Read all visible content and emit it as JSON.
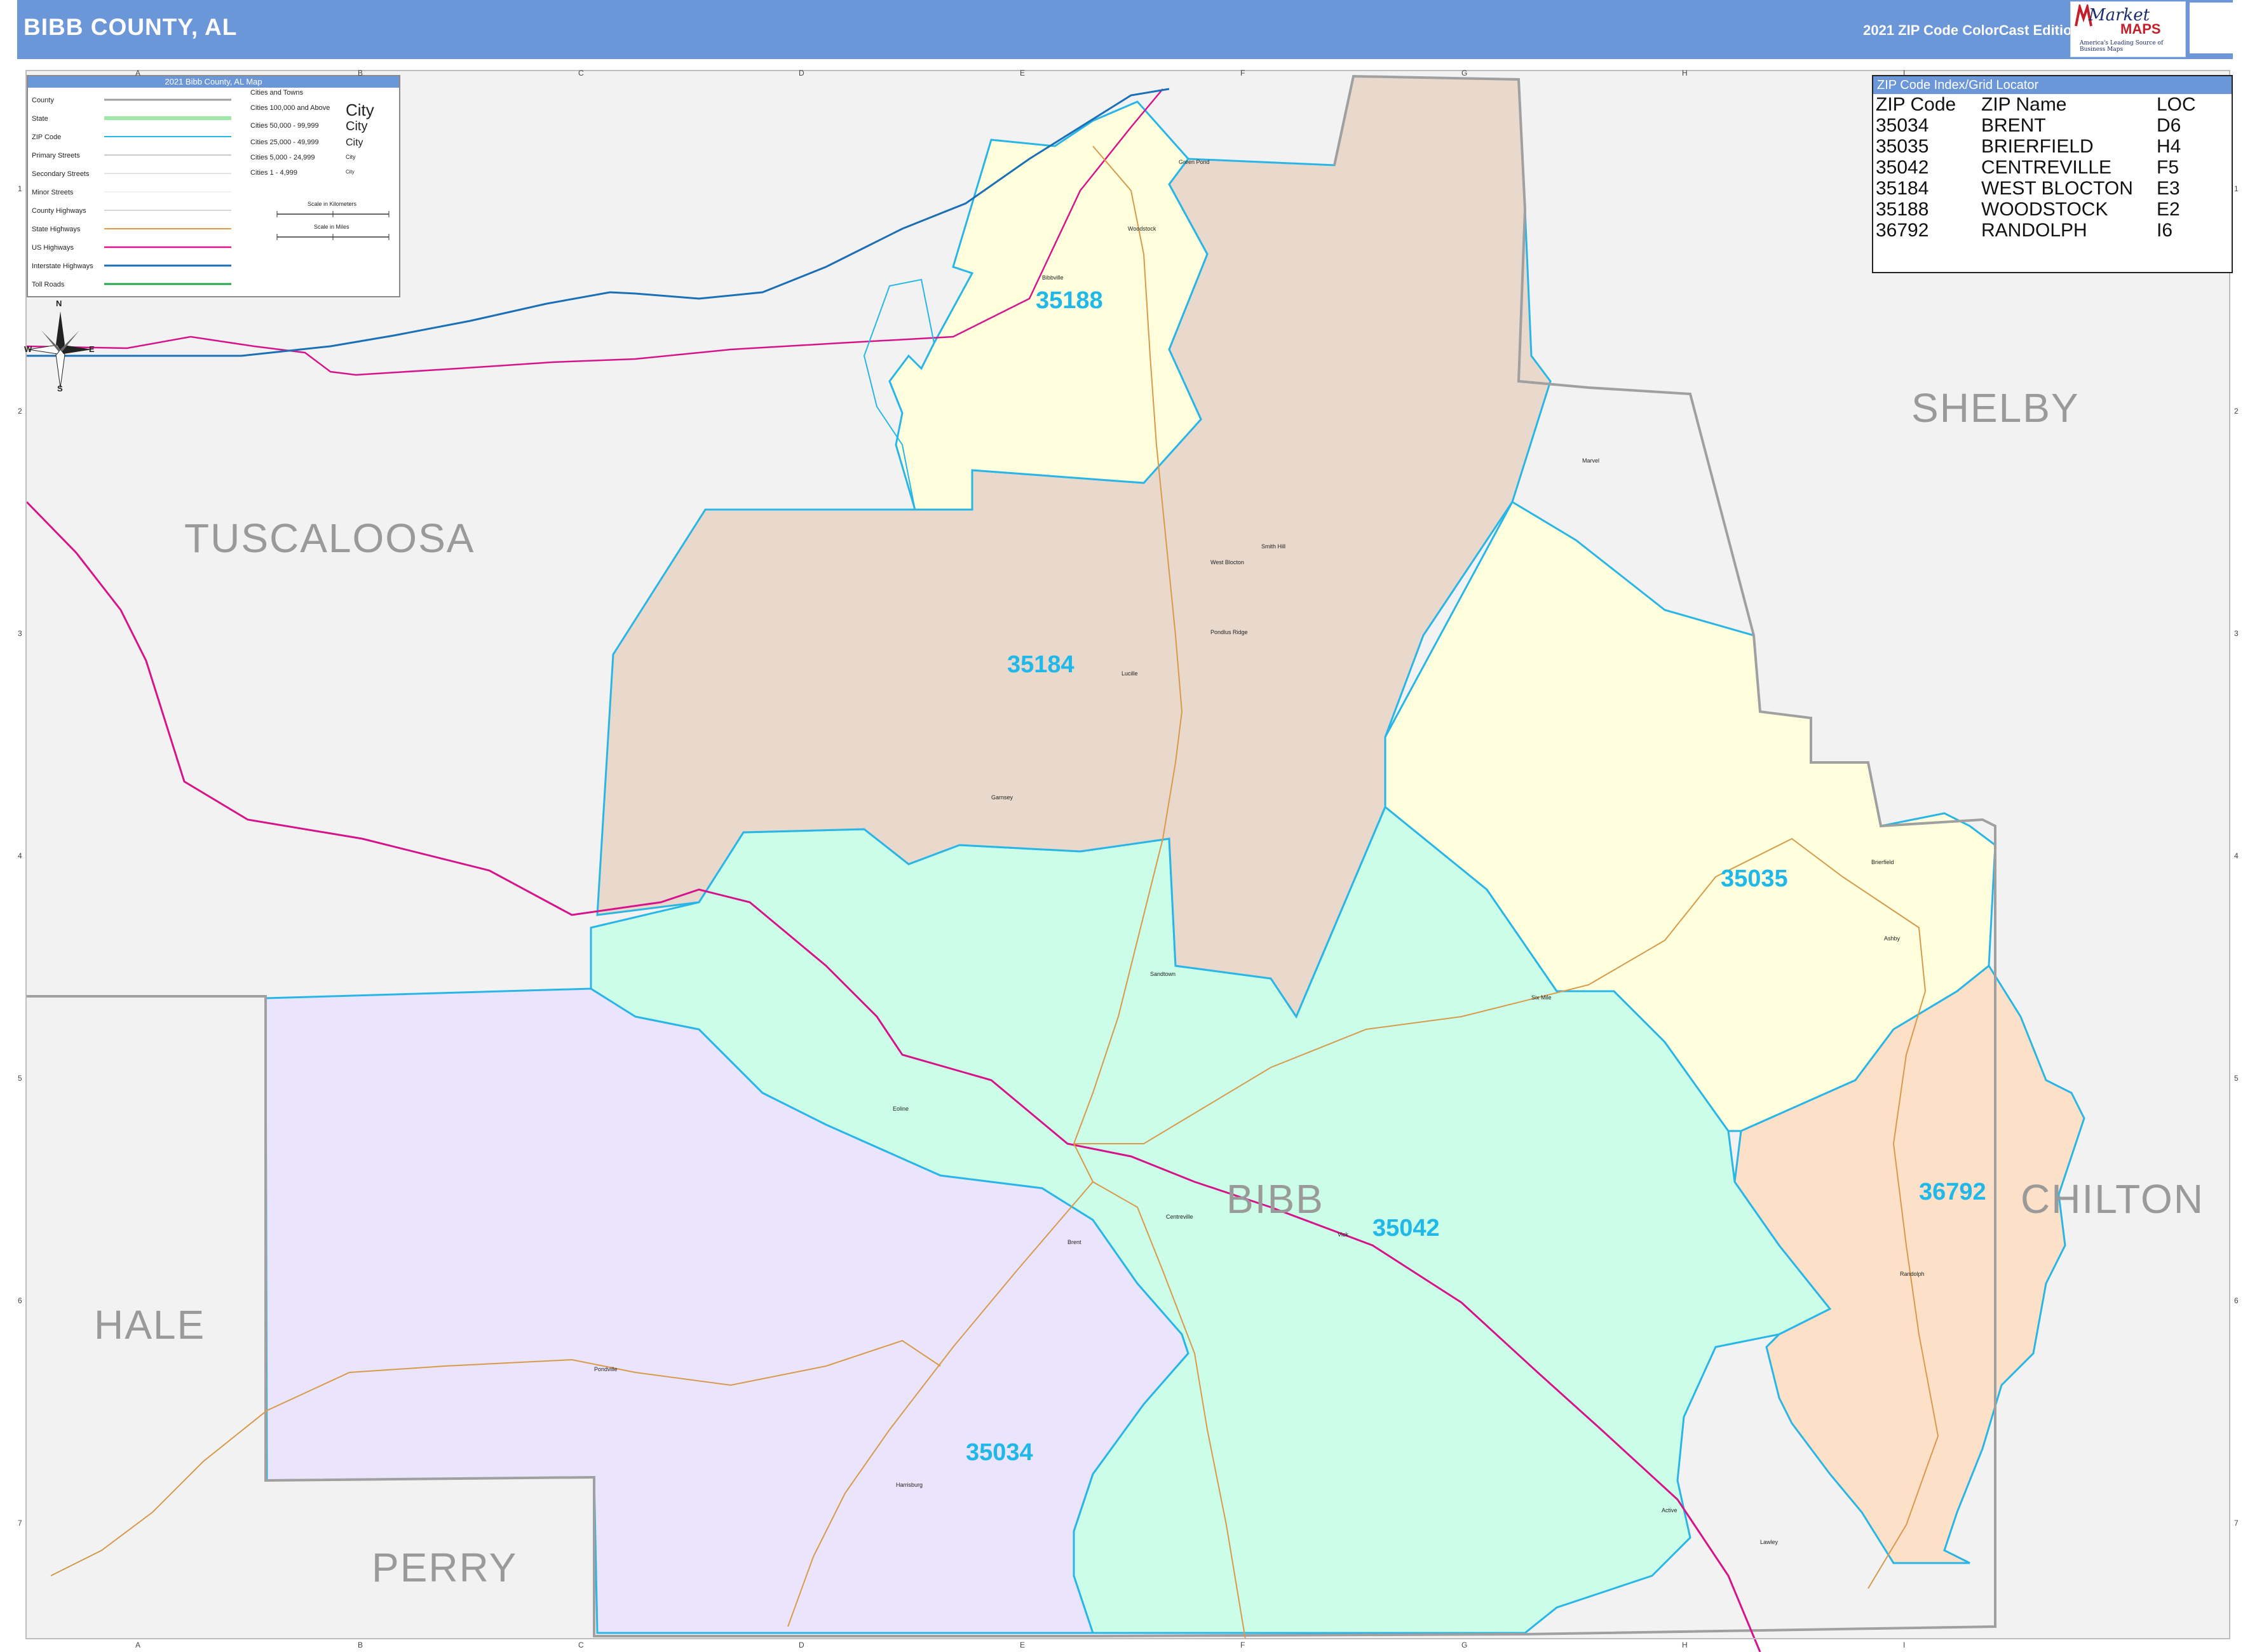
{
  "header": {
    "title": "BIBB COUNTY, AL",
    "edition": "2021 ZIP Code ColorCast Edition"
  },
  "logo": {
    "brand": "Market",
    "maps": "MAPS",
    "tagline": "America's Leading Source of Business Maps"
  },
  "legend": {
    "title": "2021 Bibb County, AL Map",
    "rows": [
      "County",
      "State",
      "ZIP Code",
      "Primary Streets",
      "Secondary Streets",
      "Minor Streets",
      "County Highways",
      "State Highways",
      "US Highways",
      "Interstate Highways",
      "Toll Roads"
    ],
    "cities_title": "Cities and Towns",
    "cities": [
      {
        "range": "Cities 100,000 and Above",
        "sample": "City"
      },
      {
        "range": "Cities 50,000 - 99,999",
        "sample": "City"
      },
      {
        "range": "Cities 25,000 - 49,999",
        "sample": "City"
      },
      {
        "range": "Cities 5,000 - 24,999",
        "sample": "City"
      },
      {
        "range": "Cities 1 - 4,999",
        "sample": "City"
      }
    ],
    "scale_km": "Scale in Kilometers",
    "scale_mi": "Scale in Miles"
  },
  "zip_index": {
    "title": "ZIP Code Index/Grid Locator",
    "columns": [
      "ZIP Code",
      "ZIP Name",
      "LOC"
    ],
    "rows": [
      [
        "35034",
        "BRENT",
        "D6"
      ],
      [
        "35035",
        "BRIERFIELD",
        "H4"
      ],
      [
        "35042",
        "CENTREVILLE",
        "F5"
      ],
      [
        "35184",
        "WEST BLOCTON",
        "E3"
      ],
      [
        "35188",
        "WOODSTOCK",
        "E2"
      ],
      [
        "36792",
        "RANDOLPH",
        "I6"
      ]
    ]
  },
  "counties": [
    "TUSCALOOSA",
    "SHELBY",
    "HALE",
    "BIBB",
    "CHILTON",
    "PERRY"
  ],
  "zip_labels": [
    "35188",
    "35184",
    "35035",
    "36792",
    "35042",
    "35034"
  ],
  "places": [
    "Woodstock",
    "Bibbville",
    "Green Pond",
    "West Blocton",
    "Smith Hill",
    "Lucille",
    "Pondlus Ridge",
    "Garnsey",
    "Marvel",
    "Brierfield",
    "Ashby",
    "Six Mile",
    "Centreville",
    "Brent",
    "Eoline",
    "Vick",
    "Pondville",
    "Harrisburg",
    "Active",
    "Lawley",
    "Randolph",
    "Sandtown"
  ],
  "grid": {
    "columns": [
      "A",
      "B",
      "C",
      "D",
      "E",
      "F",
      "G",
      "H",
      "I"
    ],
    "rows": [
      "1",
      "2",
      "3",
      "4",
      "5",
      "6",
      "7"
    ]
  },
  "compass": {
    "n": "N",
    "s": "S",
    "e": "E",
    "w": "W"
  },
  "colors": {
    "header": "#6b97d8",
    "zip_35188": "#ffffdd",
    "zip_35184": "#e8d9cc",
    "zip_35035": "#ffffdd",
    "zip_36792": "#fce0c8",
    "zip_35042": "#ccfde9",
    "zip_35034": "#ebe4fd",
    "outside": "#f2f2f2",
    "zip_border": "#29b6e6",
    "zip_text": "#1fb8e8",
    "us_highway": "#d6138a",
    "interstate": "#1a6fb5",
    "state_highway": "#d89a4a"
  }
}
